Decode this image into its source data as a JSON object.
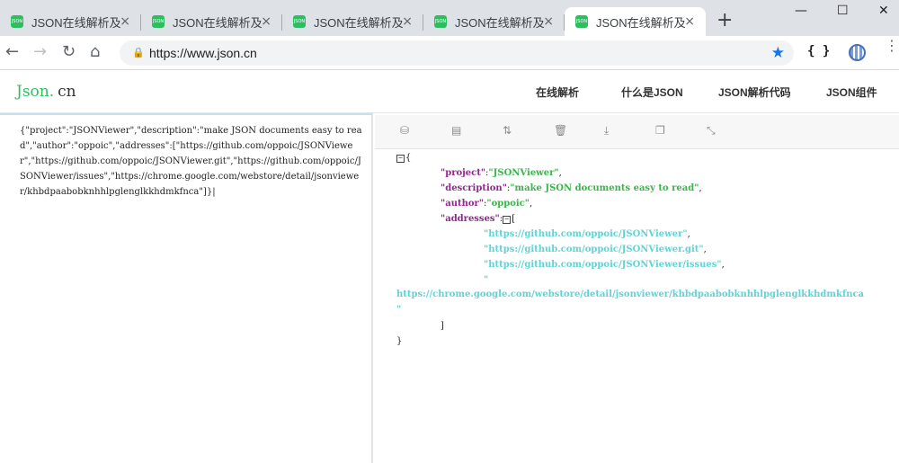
{
  "browser": {
    "tabs": [
      {
        "title": "JSON在线解析及",
        "favicon": "JSON",
        "close": "×",
        "active": false
      },
      {
        "title": "JSON在线解析及",
        "favicon": "JSON",
        "close": "×",
        "active": false
      },
      {
        "title": "JSON在线解析及",
        "favicon": "JSON",
        "close": "×",
        "active": false
      },
      {
        "title": "JSON在线解析及",
        "favicon": "JSON",
        "close": "×",
        "active": false
      },
      {
        "title": "JSON在线解析及",
        "favicon": "JSON",
        "close": "×",
        "active": true
      }
    ],
    "new_tab": "+",
    "window_controls": {
      "minimize": "—",
      "maximize": "☐",
      "close": "✕"
    },
    "nav": {
      "back": "←",
      "forward": "→",
      "reload": "↻",
      "home": "⌂"
    },
    "url": "https://www.json.cn",
    "lock": "🔒",
    "star": "★",
    "extension_json": "{ }",
    "menu": "⋮"
  },
  "site": {
    "logo_part1": "Json.",
    "logo_part2": "cn",
    "nav": [
      "在线解析",
      "什么是JSON",
      "JSON解析代码",
      "JSON组件"
    ]
  },
  "editor": {
    "raw_text": "{\"project\":\"JSONViewer\",\"description\":\"make JSON documents easy to read\",\"author\":\"oppoic\",\"addresses\":[\"https://github.com/oppoic/JSONViewer\",\"https://github.com/oppoic/JSONViewer.git\",\"https://github.com/oppoic/JSONViewer/issues\",\"https://chrome.google.com/webstore/detail/jsonviewer/khbdpaabobknhhlpglenglkkhdmkfnca\"]}|"
  },
  "toolbar_icons": [
    "database-icon",
    "excel-icon",
    "sort-icon",
    "trash-icon",
    "download-icon",
    "copy-icon",
    "compress-icon"
  ],
  "toolbar_glyphs": [
    "⛁",
    "▤",
    "⇅",
    "🗑",
    "⤓",
    "❐",
    "⤡"
  ],
  "tree": {
    "open_brace": "{",
    "close_brace": "}",
    "toggle": "−",
    "keys": {
      "project": "\"project\"",
      "description": "\"description\"",
      "author": "\"author\"",
      "addresses": "\"addresses\""
    },
    "values": {
      "project": "\"JSONViewer\"",
      "description": "\"make JSON documents easy to read\"",
      "author": "\"oppoic\""
    },
    "colon": ":",
    "comma": ",",
    "array_open": "[",
    "array_close": "]",
    "addresses": [
      "\"https://github.com/oppoic/JSONViewer\"",
      "\"https://github.com/oppoic/JSONViewer.git\"",
      "\"https://github.com/oppoic/JSONViewer/issues\""
    ],
    "last_address_open_quote": "\"",
    "last_address_url": "https://chrome.google.com/webstore/detail/jsonviewer/khbdpaabobknhhlpglenglkkhdmkfnca",
    "last_address_close_quote": "\""
  }
}
